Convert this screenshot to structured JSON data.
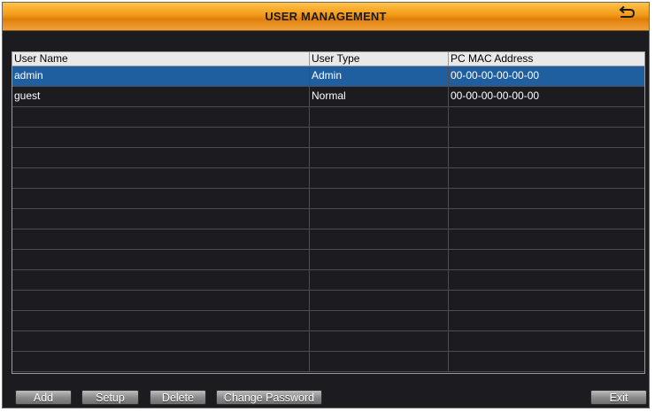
{
  "window": {
    "title": "USER MANAGEMENT"
  },
  "table": {
    "columns": [
      "User Name",
      "User Type",
      "PC MAC Address"
    ],
    "rows": [
      {
        "name": "admin",
        "type": "Admin",
        "mac": "00-00-00-00-00-00",
        "selected": true
      },
      {
        "name": "guest",
        "type": "Normal",
        "mac": "00-00-00-00-00-00",
        "selected": false
      }
    ],
    "empty_row_count": 13
  },
  "buttons": {
    "add": "Add",
    "setup": "Setup",
    "delete": "Delete",
    "change_password": "Change Password",
    "exit": "Exit"
  },
  "icons": {
    "back": "back-arrow-icon"
  },
  "colors": {
    "title_bar": "#f29a18",
    "background": "#1c1c20",
    "selected_row": "#1f5fa0",
    "header_row": "#e9e9e9"
  }
}
